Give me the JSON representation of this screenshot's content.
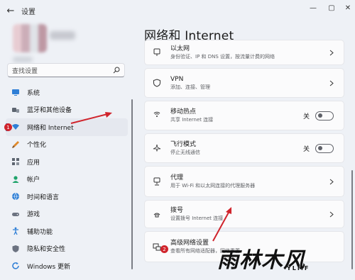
{
  "window": {
    "title": "设置",
    "back_icon": "back-arrow-icon",
    "controls": {
      "minimize": "—",
      "maximize": "▢",
      "close": "✕"
    }
  },
  "search": {
    "placeholder": "查找设置"
  },
  "sidebar": {
    "items": [
      {
        "label": "系统",
        "icon": "system-icon"
      },
      {
        "label": "蓝牙和其他设备",
        "icon": "bluetooth-icon"
      },
      {
        "label": "网络和 Internet",
        "icon": "wifi-icon",
        "badge": "1"
      },
      {
        "label": "个性化",
        "icon": "brush-icon"
      },
      {
        "label": "应用",
        "icon": "apps-icon"
      },
      {
        "label": "帐户",
        "icon": "account-icon"
      },
      {
        "label": "时间和语言",
        "icon": "globe-icon"
      },
      {
        "label": "游戏",
        "icon": "gamepad-icon"
      },
      {
        "label": "辅助功能",
        "icon": "accessibility-icon"
      },
      {
        "label": "隐私和安全性",
        "icon": "shield-icon"
      },
      {
        "label": "Windows 更新",
        "icon": "update-icon"
      }
    ]
  },
  "main": {
    "title": "网络和 Internet",
    "cards": [
      {
        "title": "以太网",
        "subtitle": "身份验证、IP 和 DNS 设置，按流量计费的网络",
        "icon": "ethernet-icon"
      },
      {
        "title": "VPN",
        "subtitle": "添加、连接、管理",
        "icon": "vpn-shield-icon"
      },
      {
        "title": "移动热点",
        "subtitle": "共享 Internet 连接",
        "icon": "hotspot-icon",
        "toggle_label": "关",
        "toggle_on": false
      },
      {
        "title": "飞行模式",
        "subtitle": "停止无线通信",
        "icon": "airplane-icon",
        "toggle_label": "关",
        "toggle_on": false
      },
      {
        "title": "代理",
        "subtitle": "用于 Wi-Fi 和以太网连接的代理服务器",
        "icon": "proxy-icon"
      },
      {
        "title": "拨号",
        "subtitle": "设置拨号 Internet 连接",
        "icon": "dialup-icon"
      },
      {
        "title": "高级网络设置",
        "subtitle": "查看所有网络适配器，网络重置",
        "icon": "network-adapter-icon",
        "badge": "2"
      }
    ]
  },
  "colors": {
    "accent": "#0067c0",
    "badge": "#d0242c",
    "background": "#eef1f6"
  },
  "watermark": {
    "main": "雨林木风",
    "sub": "YLMF"
  }
}
